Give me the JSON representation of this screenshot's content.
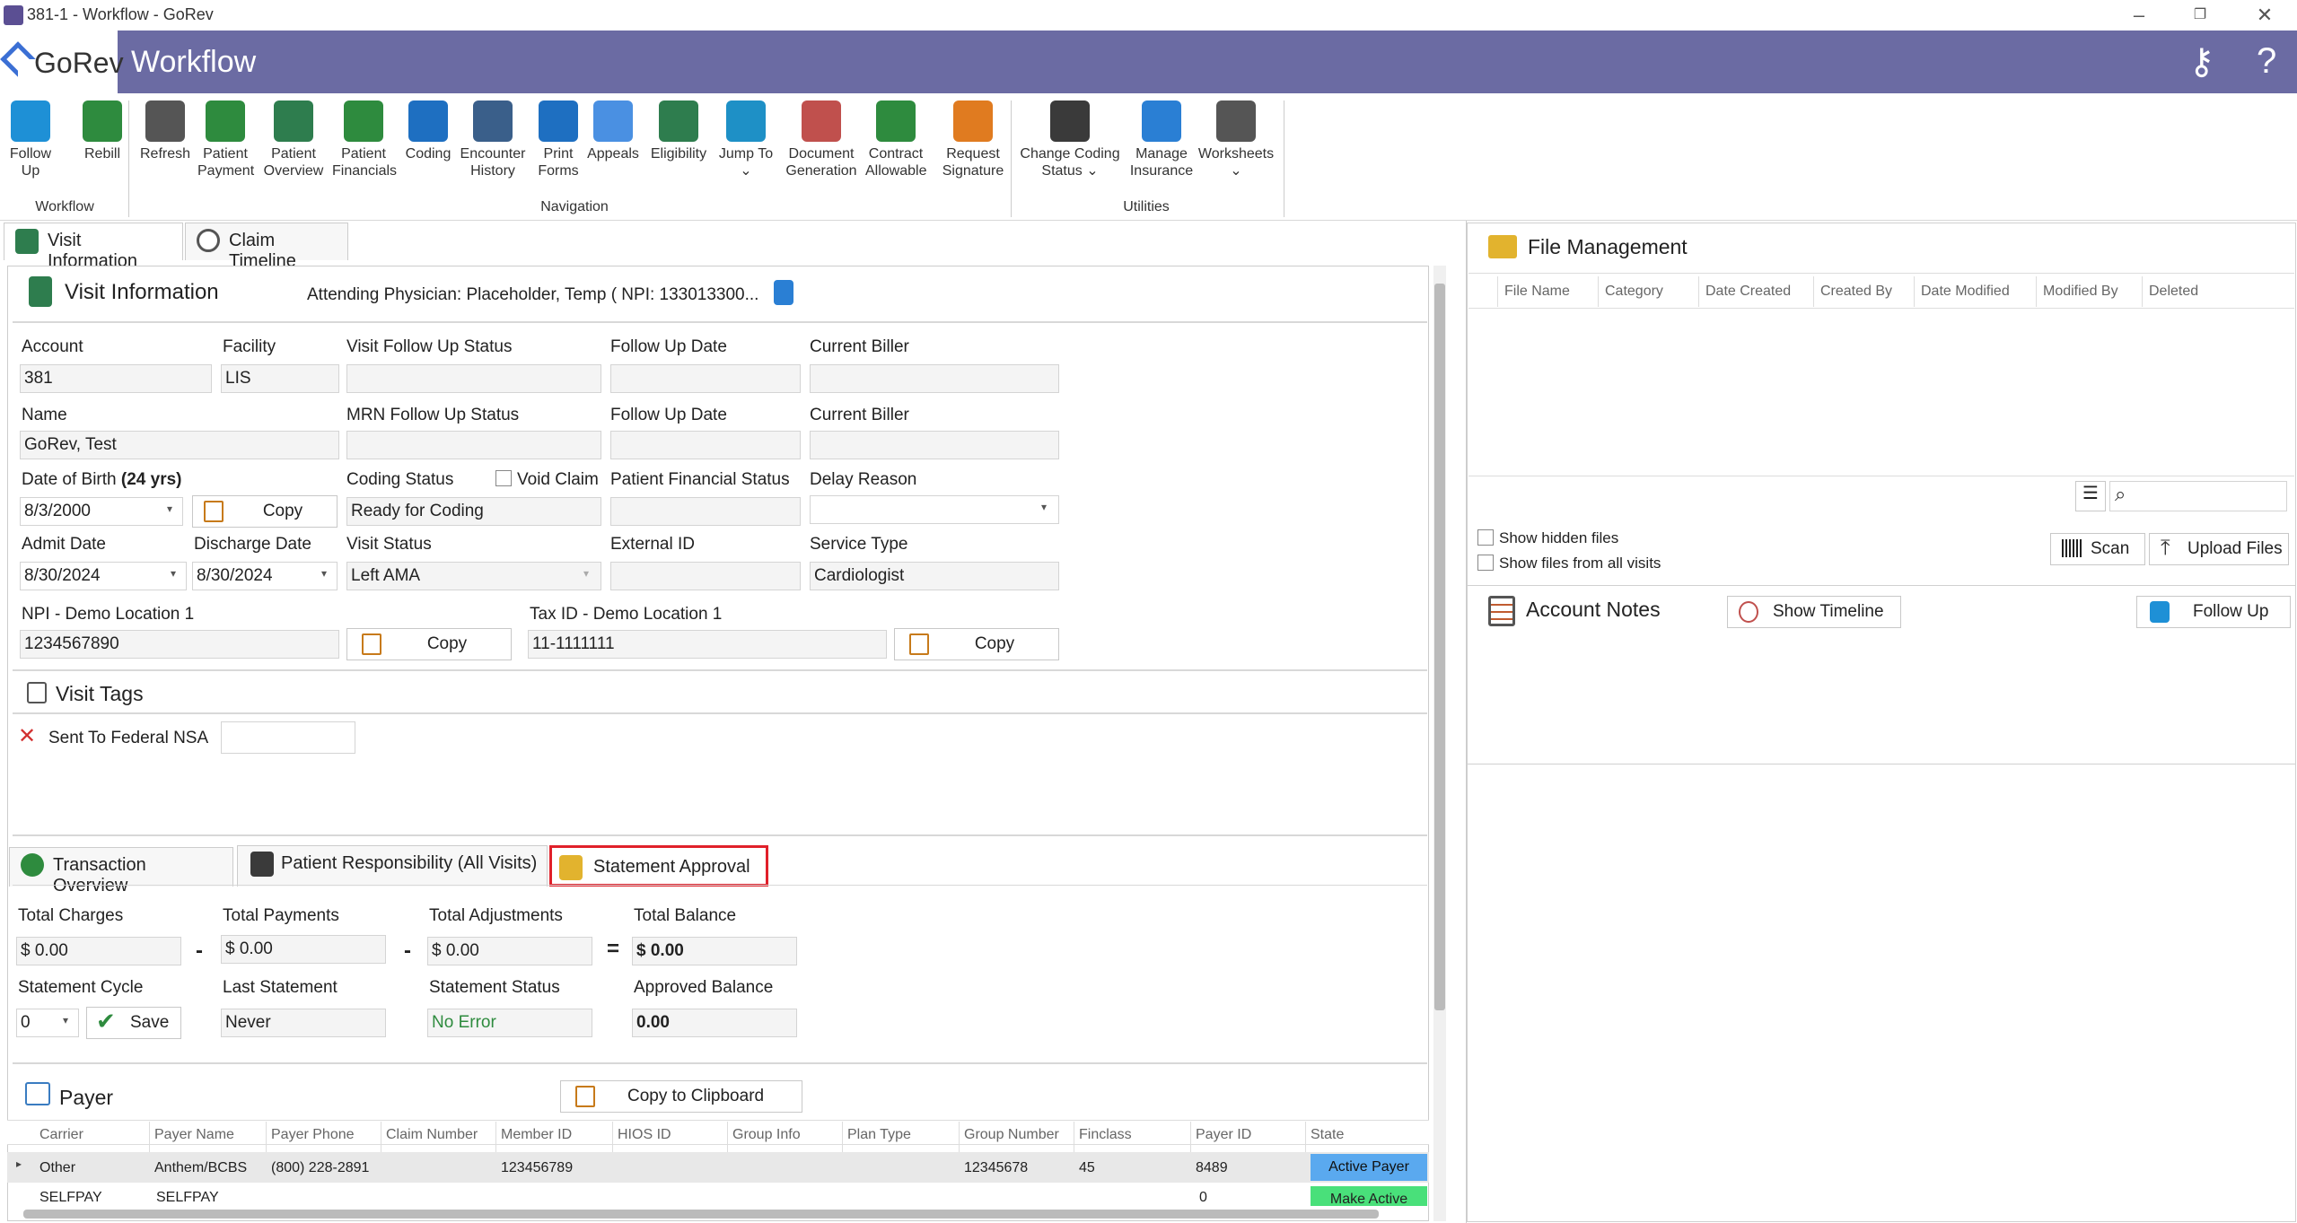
{
  "window": {
    "title": "381-1 - Workflow - GoRev",
    "app_name": "GoRev",
    "section_title": "Workflow"
  },
  "ribbon": {
    "buttons": [
      {
        "label1": "Follow",
        "label2": "Up",
        "icon": "follow-up-icon",
        "color": "#1e90d6"
      },
      {
        "label1": "Rebill",
        "label2": "",
        "icon": "rebill-icon",
        "color": "#2e8b3e"
      },
      {
        "label1": "Refresh",
        "label2": "",
        "icon": "refresh-icon",
        "color": "#555555"
      },
      {
        "label1": "Patient",
        "label2": "Payment",
        "icon": "patient-payment-icon",
        "color": "#2e8b3e"
      },
      {
        "label1": "Patient",
        "label2": "Overview",
        "icon": "patient-overview-icon",
        "color": "#2e7d4e"
      },
      {
        "label1": "Patient",
        "label2": "Financials",
        "icon": "patient-financials-icon",
        "color": "#2e8b3e"
      },
      {
        "label1": "Coding",
        "label2": "",
        "icon": "coding-icon",
        "color": "#1e6fc1"
      },
      {
        "label1": "Encounter",
        "label2": "History",
        "icon": "encounter-history-icon",
        "color": "#3a5f8a"
      },
      {
        "label1": "Print",
        "label2": "Forms",
        "icon": "print-forms-icon",
        "color": "#1e6fc1"
      },
      {
        "label1": "Appeals",
        "label2": "",
        "icon": "appeals-icon",
        "color": "#4a90e2"
      },
      {
        "label1": "Eligibility",
        "label2": "",
        "icon": "eligibility-icon",
        "color": "#2e7d4e"
      },
      {
        "label1": "Jump To",
        "label2": "⌄",
        "icon": "jump-to-icon",
        "color": "#1e90c6"
      },
      {
        "label1": "Document",
        "label2": "Generation",
        "icon": "document-generation-icon",
        "color": "#c0504d"
      },
      {
        "label1": "Contract",
        "label2": "Allowable",
        "icon": "contract-allowable-icon",
        "color": "#2e8b3e"
      },
      {
        "label1": "Request",
        "label2": "Signature",
        "icon": "request-signature-icon",
        "color": "#e07b20"
      },
      {
        "label1": "Change Coding",
        "label2": "Status ⌄",
        "icon": "change-coding-status-icon",
        "color": "#3a3a3a"
      },
      {
        "label1": "Manage",
        "label2": "Insurance",
        "icon": "manage-insurance-icon",
        "color": "#2a7fd4"
      },
      {
        "label1": "Worksheets",
        "label2": "⌄",
        "icon": "worksheets-icon",
        "color": "#555555"
      }
    ],
    "groups": {
      "workflow": "Workflow",
      "navigation": "Navigation",
      "utilities": "Utilities"
    }
  },
  "tabs": {
    "visit_information": "Visit Information",
    "claim_timeline": "Claim Timeline"
  },
  "visit": {
    "title": "Visit Information",
    "attending": "Attending Physician: Placeholder, Temp ( NPI: 133013300...",
    "account_label": "Account",
    "account": "381",
    "facility_label": "Facility",
    "facility": "LIS",
    "visit_follow_up_status_label": "Visit Follow Up Status",
    "follow_up_date_label": "Follow Up Date",
    "current_biller_label": "Current Biller",
    "name_label": "Name",
    "name": "GoRev, Test",
    "mrn_follow_up_status_label": "MRN Follow Up Status",
    "follow_up_date2_label": "Follow Up Date",
    "current_biller2_label": "Current Biller",
    "dob_label": "Date of Birth",
    "age": "(24 yrs)",
    "dob": "8/3/2000",
    "copy_label": "Copy",
    "coding_status_label": "Coding Status",
    "coding_status": "Ready for Coding",
    "void_claim_label": "Void Claim",
    "patient_financial_status_label": "Patient Financial Status",
    "delay_reason_label": "Delay Reason",
    "admit_date_label": "Admit Date",
    "admit_date": "8/30/2024",
    "discharge_date_label": "Discharge Date",
    "discharge_date": "8/30/2024",
    "visit_status_label": "Visit Status",
    "visit_status": "Left AMA",
    "external_id_label": "External ID",
    "service_type_label": "Service Type",
    "service_type": "Cardiologist",
    "npi_label": "NPI - Demo Location 1",
    "npi": "1234567890",
    "tax_id_label": "Tax ID - Demo Location 1",
    "tax_id": "11-1111111"
  },
  "tags": {
    "title": "Visit Tags",
    "tag1": "Sent To Federal NSA"
  },
  "subtabs": {
    "transaction_overview": "Transaction Overview",
    "patient_responsibility": "Patient Responsibility (All Visits)",
    "statement_approval": "Statement Approval"
  },
  "statement": {
    "total_charges_label": "Total Charges",
    "total_charges": "$ 0.00",
    "total_payments_label": "Total Payments",
    "total_payments": "$ 0.00",
    "total_adjustments_label": "Total Adjustments",
    "total_adjustments": "$ 0.00",
    "total_balance_label": "Total Balance",
    "total_balance": "$ 0.00",
    "minus": "-",
    "equals": "=",
    "statement_cycle_label": "Statement Cycle",
    "statement_cycle": "0",
    "save_label": "Save",
    "last_statement_label": "Last Statement",
    "last_statement": "Never",
    "statement_status_label": "Statement Status",
    "statement_status": "No Error",
    "approved_balance_label": "Approved Balance",
    "approved_balance": "0.00"
  },
  "payer": {
    "title": "Payer",
    "copy_clipboard": "Copy to Clipboard",
    "columns": [
      "Carrier",
      "Payer Name",
      "Payer Phone",
      "Claim Number",
      "Member ID",
      "HIOS ID",
      "Group Info",
      "Plan Type",
      "Group Number",
      "Finclass",
      "Payer ID",
      "State"
    ],
    "rows": [
      {
        "carrier": "Other",
        "payer_name": "Anthem/BCBS",
        "payer_phone": "(800) 228-2891",
        "claim_number": "",
        "member_id": "123456789",
        "hios_id": "",
        "group_info": "",
        "plan_type": "",
        "group_number": "12345678",
        "finclass": "45",
        "payer_id": "8489",
        "state": "Active Payer"
      },
      {
        "carrier": "SELFPAY",
        "payer_name": "SELFPAY",
        "payer_phone": "",
        "claim_number": "",
        "member_id": "",
        "hios_id": "",
        "group_info": "",
        "plan_type": "",
        "group_number": "",
        "finclass": "",
        "payer_id": "0",
        "state": "Make Active"
      }
    ]
  },
  "files": {
    "title": "File Management",
    "columns": [
      "File Name",
      "Category",
      "Date Created",
      "Created By",
      "Date Modified",
      "Modified By",
      "Deleted"
    ],
    "show_hidden": "Show hidden files",
    "show_all_visits": "Show files from all visits",
    "scan_label": "Scan",
    "upload_label": "Upload Files"
  },
  "notes": {
    "title": "Account Notes",
    "show_timeline": "Show Timeline",
    "follow_up": "Follow Up"
  },
  "colors": {
    "header": "#6b6ba3",
    "highlight_red": "#e0202a",
    "active_payer": "#5aa9ef",
    "make_active": "#49e07a",
    "no_error": "#2e8b3e"
  }
}
